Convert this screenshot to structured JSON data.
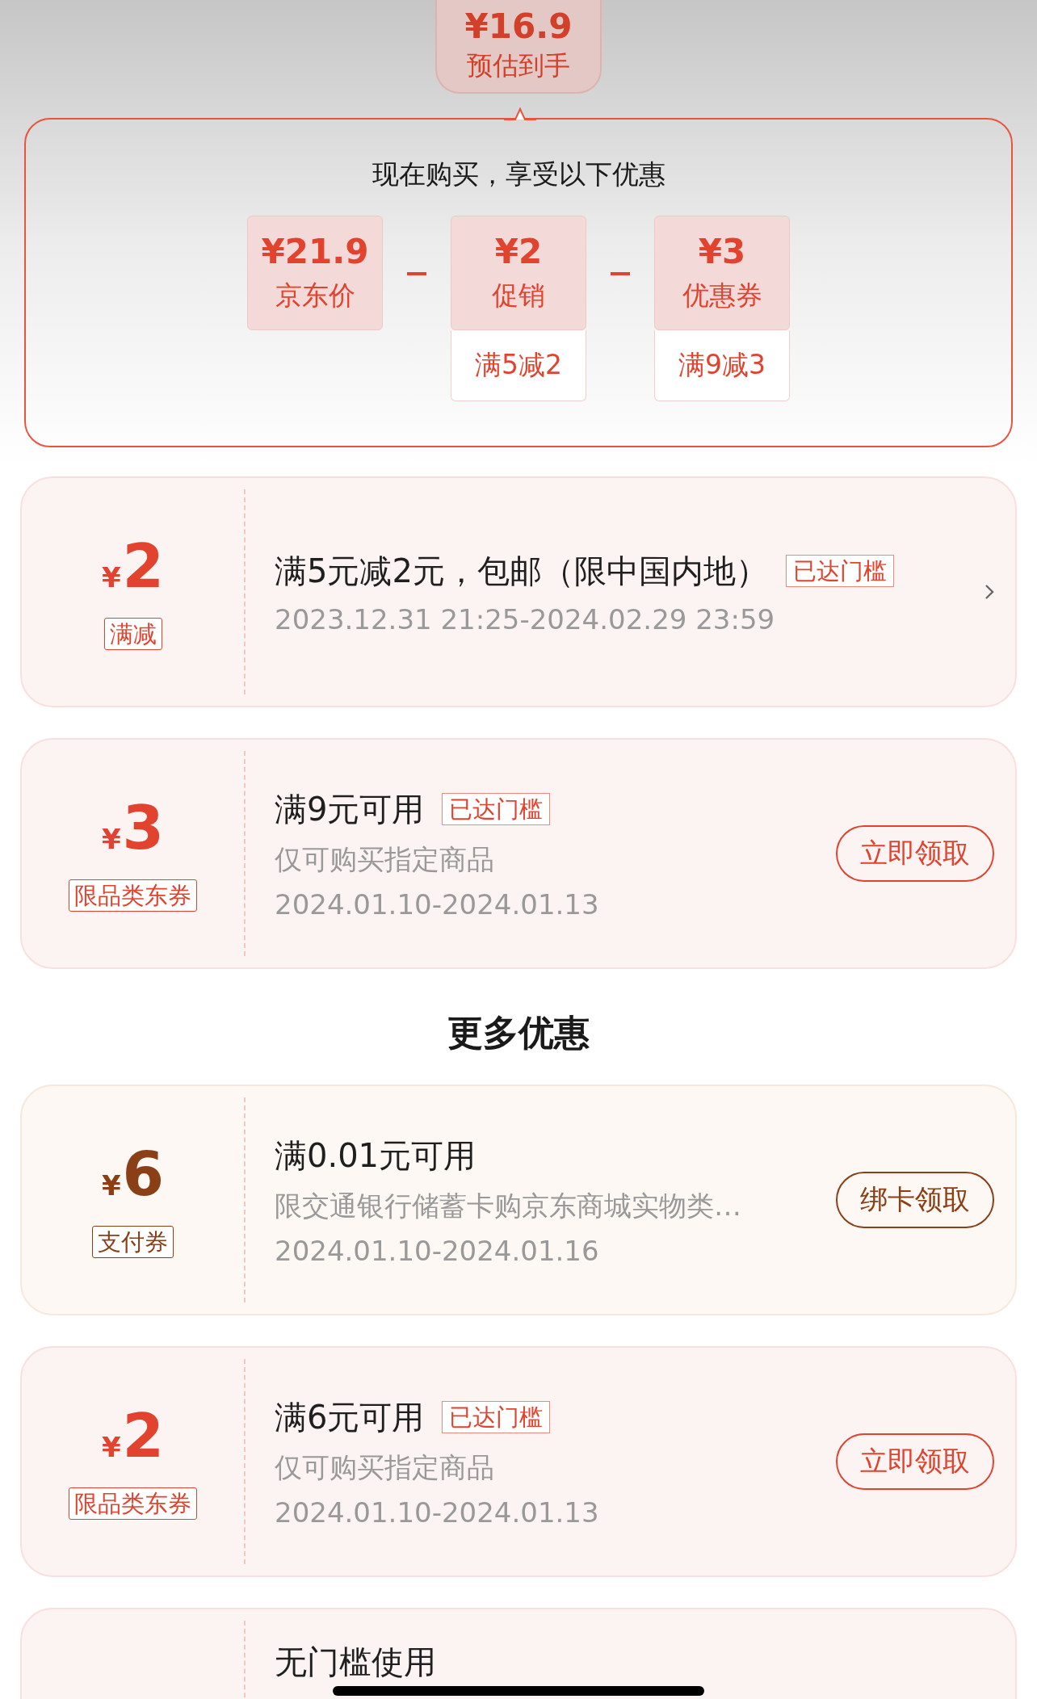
{
  "price_bubble": {
    "amount": "¥16.9",
    "label": "预估到手"
  },
  "breakdown": {
    "title": "现在购买，享受以下优惠",
    "items": [
      {
        "amount": "¥21.9",
        "label": "京东价"
      },
      {
        "amount": "¥2",
        "label": "促销",
        "condition": "满5减2"
      },
      {
        "amount": "¥3",
        "label": "优惠券",
        "condition": "满9减3"
      }
    ]
  },
  "coupons": [
    {
      "kind": "store",
      "color": "#e2432e",
      "symbol": "¥",
      "amount": "2",
      "tag": "满减",
      "title": "满5元减2元，包邮（限中国内地）",
      "badge": "已达门槛",
      "validity": "2023.12.31 21:25-2024.02.29 23:59",
      "action": {
        "kind": "chevron"
      }
    },
    {
      "kind": "store",
      "color": "#e2432e",
      "symbol": "¥",
      "amount": "3",
      "tag": "限品类东券",
      "title": "满9元可用",
      "badge": "已达门槛",
      "subtitle": "仅可购买指定商品",
      "validity": "2024.01.10-2024.01.13",
      "action": {
        "kind": "button",
        "label": "立即领取"
      }
    }
  ],
  "more": {
    "heading": "更多优惠",
    "coupons": [
      {
        "kind": "payment",
        "color": "#8a3f16",
        "symbol": "¥",
        "amount": "6",
        "tag": "支付券",
        "title": "满0.01元可用",
        "subtitle": "限交通银行储蓄卡购京东商城实物类…",
        "validity": "2024.01.10-2024.01.16",
        "action": {
          "kind": "button",
          "label": "绑卡领取"
        }
      },
      {
        "kind": "store",
        "color": "#e2432e",
        "symbol": "¥",
        "amount": "2",
        "tag": "限品类东券",
        "title": "满6元可用",
        "badge": "已达门槛",
        "subtitle": "仅可购买指定商品",
        "validity": "2024.01.10-2024.01.13",
        "action": {
          "kind": "button",
          "label": "立即领取"
        }
      },
      {
        "kind": "store",
        "title": "无门槛使用"
      }
    ]
  }
}
